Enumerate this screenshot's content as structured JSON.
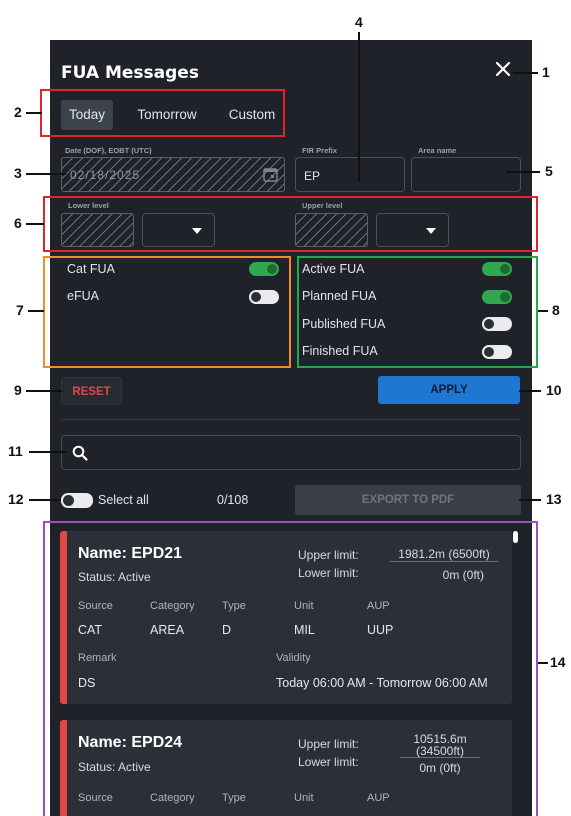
{
  "header": {
    "title": "FUA Messages",
    "close_icon": "close-icon"
  },
  "tabs": [
    {
      "label": "Today",
      "active": true
    },
    {
      "label": "Tomorrow",
      "active": false
    },
    {
      "label": "Custom",
      "active": false
    }
  ],
  "filters": {
    "date_label": "Date (DOF), EOBT (UTC)",
    "date_value": "02/18/2025",
    "fir_label": "FIR Prefix",
    "fir_value": "EP",
    "area_label": "Area name",
    "area_value": "",
    "lower_label": "Lower level",
    "upper_label": "Upper level"
  },
  "categories": [
    {
      "label": "Cat FUA",
      "on": true
    },
    {
      "label": "eFUA",
      "on": false
    }
  ],
  "statuses": [
    {
      "label": "Active FUA",
      "on": true
    },
    {
      "label": "Planned FUA",
      "on": true
    },
    {
      "label": "Published FUA",
      "on": false
    },
    {
      "label": "Finished FUA",
      "on": false
    }
  ],
  "actions": {
    "reset": "RESET",
    "apply": "APPLY",
    "export": "EXPORT TO PDF"
  },
  "search": {
    "placeholder": ""
  },
  "selection": {
    "select_all": "Select all",
    "count": "0/108"
  },
  "cards": [
    {
      "name": "Name: EPD21",
      "status": "Status: Active",
      "upper_label": "Upper limit:",
      "upper_value": "1981.2m (6500ft)",
      "lower_label": "Lower limit:",
      "lower_value": "0m (0ft)",
      "headers": [
        "Source",
        "Category",
        "Type",
        "Unit",
        "AUP"
      ],
      "values": [
        "CAT",
        "AREA",
        "D",
        "MIL",
        "UUP"
      ],
      "remark_label": "Remark",
      "remark": "DS",
      "validity_label": "Validity",
      "validity": "Today 06:00 AM - Tomorrow 06:00 AM"
    },
    {
      "name": "Name: EPD24",
      "status": "Status: Active",
      "upper_label": "Upper limit:",
      "upper_value": "10515.6m (34500ft)",
      "lower_label": "Lower limit:",
      "lower_value": "0m (0ft)",
      "headers": [
        "Source",
        "Category",
        "Type",
        "Unit",
        "AUP"
      ]
    }
  ],
  "callouts": [
    "1",
    "2",
    "3",
    "4",
    "5",
    "6",
    "7",
    "8",
    "9",
    "10",
    "11",
    "12",
    "13",
    "14"
  ],
  "colors": {
    "panel": "#1f2329",
    "card": "#2b3038",
    "accent_red": "#e64545",
    "apply_blue": "#1f77d4",
    "toggle_on": "#2fa84f"
  }
}
